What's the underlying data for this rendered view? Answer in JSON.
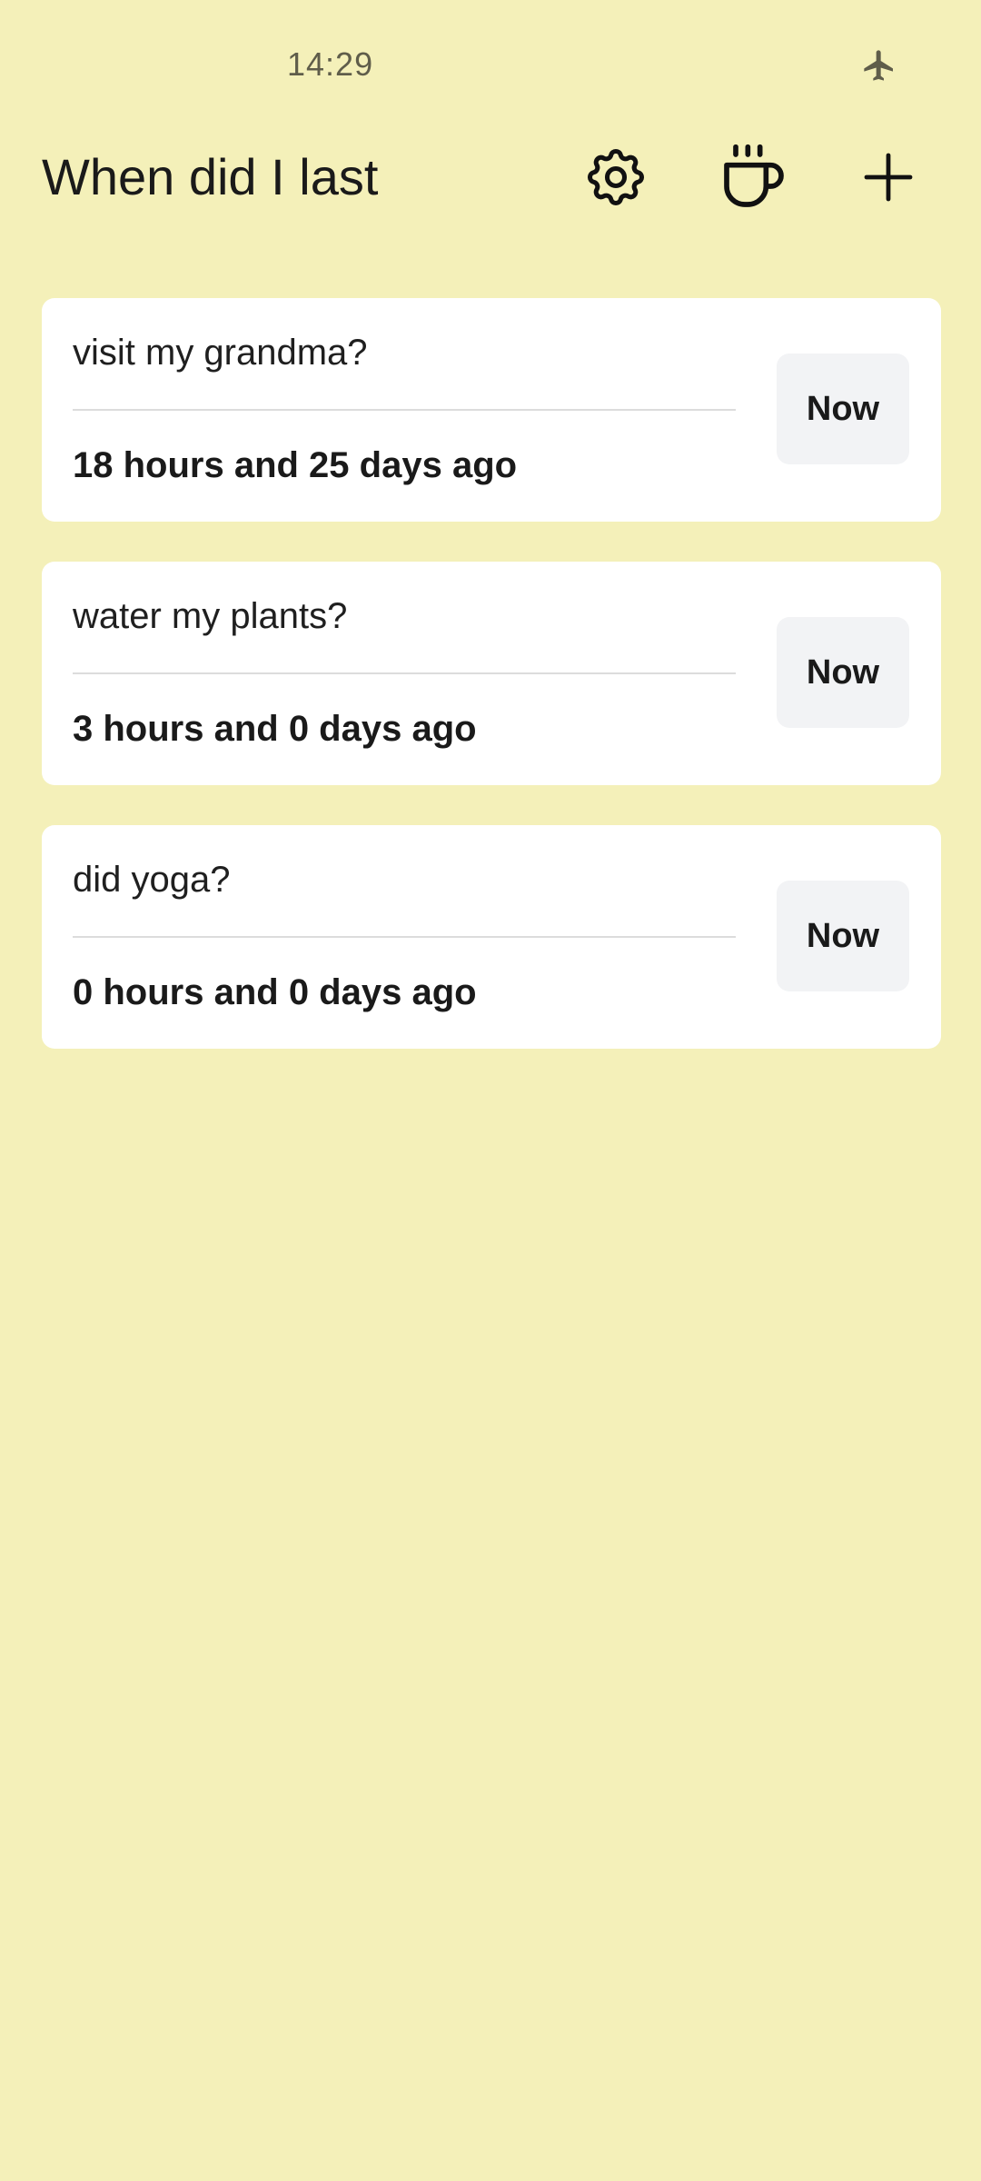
{
  "status_bar": {
    "time": "14:29",
    "airplane_icon": "airplane-mode-icon"
  },
  "header": {
    "title": "When did I last",
    "actions": [
      {
        "name": "settings",
        "icon": "gear-icon"
      },
      {
        "name": "coffee",
        "icon": "coffee-cup-icon"
      },
      {
        "name": "add",
        "icon": "plus-icon"
      }
    ]
  },
  "colors": {
    "background": "#F4F0B9",
    "card": "#FFFFFF",
    "button": "#F2F3F5",
    "text": "#1A1A1A"
  },
  "items": [
    {
      "name": "visit my grandma?",
      "ago": "18 hours and 25 days ago",
      "button_label": "Now"
    },
    {
      "name": "water my plants?",
      "ago": "3 hours and 0 days ago",
      "button_label": "Now"
    },
    {
      "name": "did yoga?",
      "ago": "0 hours and 0 days ago",
      "button_label": "Now"
    }
  ]
}
